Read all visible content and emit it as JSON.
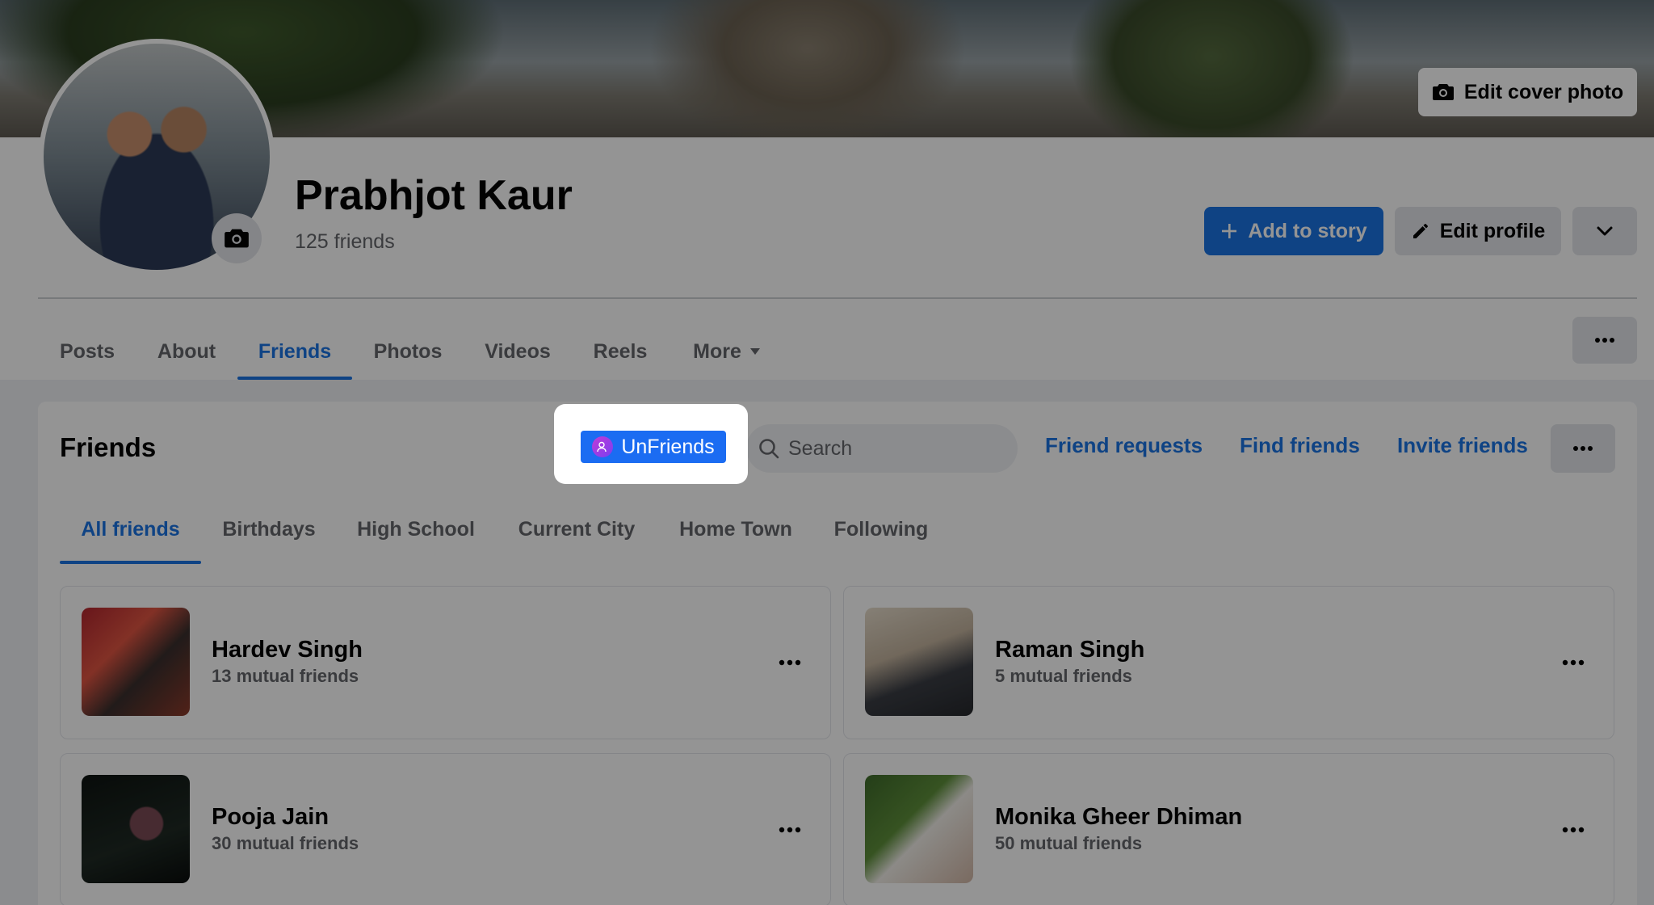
{
  "cover": {
    "edit_cover_label": "Edit cover photo"
  },
  "profile": {
    "name": "Prabhjot Kaur",
    "friend_count": "125 friends",
    "add_story_label": "Add to story",
    "edit_profile_label": "Edit profile"
  },
  "nav_tabs": [
    "Posts",
    "About",
    "Friends",
    "Photos",
    "Videos",
    "Reels",
    "More"
  ],
  "friends_section": {
    "title": "Friends",
    "search_placeholder": "Search",
    "links": [
      "Friend requests",
      "Find friends",
      "Invite friends"
    ],
    "subtabs": [
      "All friends",
      "Birthdays",
      "High School",
      "Current City",
      "Home Town",
      "Following"
    ],
    "list": [
      {
        "name": "Hardev Singh",
        "mutual": "13 mutual friends"
      },
      {
        "name": "Raman Singh",
        "mutual": "5 mutual friends"
      },
      {
        "name": "Pooja Jain",
        "mutual": "30 mutual friends"
      },
      {
        "name": "Monika Gheer Dhiman",
        "mutual": "50 mutual friends"
      }
    ]
  },
  "extension": {
    "unfriends_label": "UnFriends"
  },
  "colors": {
    "accent": "#1b74e4",
    "extension_button": "#1b6cf2"
  }
}
